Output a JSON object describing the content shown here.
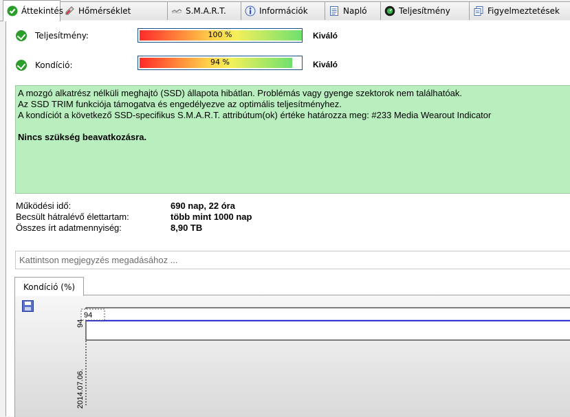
{
  "tabs": [
    {
      "label": "Áttekintés",
      "icon": "check-icon",
      "active": true
    },
    {
      "label": "Hőmérséklet",
      "icon": "thermometer-icon",
      "active": false
    },
    {
      "label": "S.M.A.R.T.",
      "icon": "smart-icon",
      "active": false
    },
    {
      "label": "Információk",
      "icon": "info-icon",
      "active": false
    },
    {
      "label": "Napló",
      "icon": "log-icon",
      "active": false
    },
    {
      "label": "Teljesítmény",
      "icon": "performance-icon",
      "active": false
    },
    {
      "label": "Figyelmeztetések",
      "icon": "warnings-icon",
      "active": false
    }
  ],
  "performance": {
    "label": "Teljesítmény:",
    "value": 100,
    "value_text": "100 %",
    "rating": "Kiváló"
  },
  "condition": {
    "label": "Kondíció:",
    "value": 94,
    "value_text": "94 %",
    "rating": "Kiváló"
  },
  "message": {
    "line1": "A mozgó alkatrész nélküli meghajtó (SSD) állapota hibátlan. Problémás vagy gyenge szektorok nem találhatóak.",
    "line2": "Az SSD TRIM funkciója támogatva és engedélyezve az optimális teljesítményhez.",
    "line3": "A kondíciót a következő SSD-specifikus S.M.A.R.T. attribútum(ok) értéke határozza meg:  #233 Media Wearout Indicator",
    "bold": "Nincs szükség beavatkozásra."
  },
  "stats": [
    {
      "label": "Működési idő:",
      "value": "690 nap, 22 óra"
    },
    {
      "label": "Becsült hátralévő élettartam:",
      "value": "több mint 1000 nap"
    },
    {
      "label": "Összes írt adatmennyiség:",
      "value": "8,90 TB"
    }
  ],
  "note_placeholder": "Kattintson megjegyzés megadásához ...",
  "chart_tab": "Kondíció  (%)",
  "chart_data": {
    "type": "line",
    "x": [
      "2014.07.06."
    ],
    "series": [
      {
        "values": [
          94
        ]
      }
    ],
    "point_label": "94",
    "y_tick": "94",
    "color": "#1f1fd0"
  }
}
